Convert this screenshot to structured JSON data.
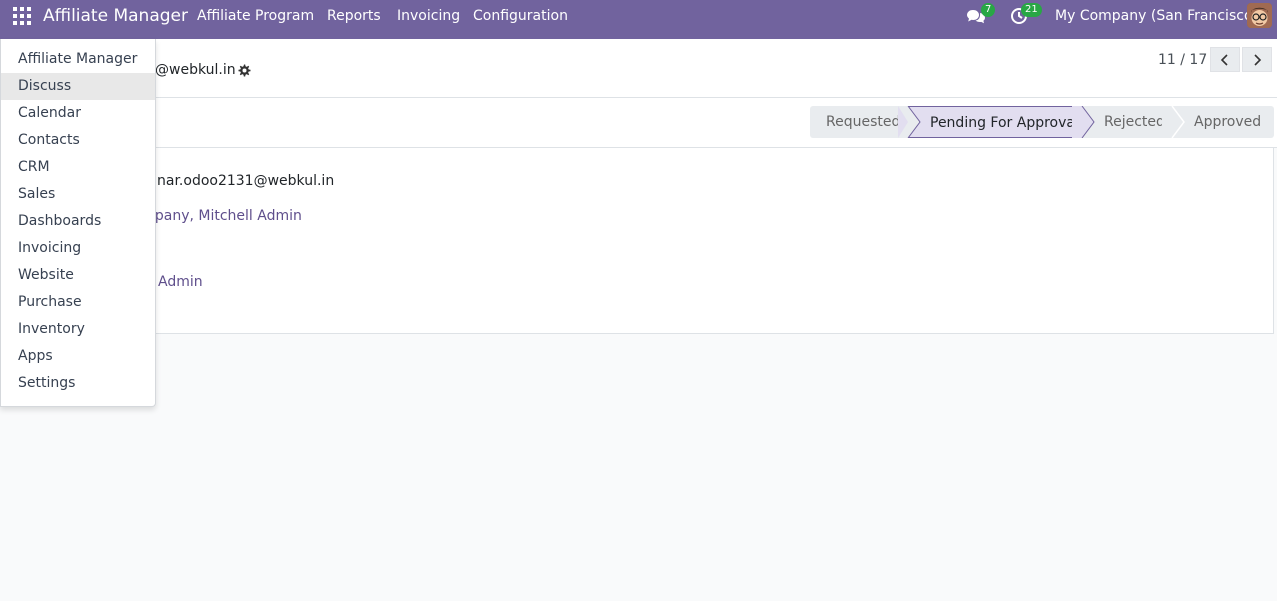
{
  "navbar": {
    "brand": "Affiliate Manager",
    "menus": [
      "Affiliate Program",
      "Reports",
      "Invoicing",
      "Configuration"
    ],
    "messages_count": "7",
    "activities_count": "21",
    "company": "My Company (San Francisco)",
    "accent_color": "#71639e"
  },
  "record": {
    "title_visible": "@webkul.in",
    "pager": "11 / 17"
  },
  "statusbar": {
    "stages": [
      "Requested",
      "Pending For Approval",
      "Rejected",
      "Approved"
    ],
    "active_stage": "Pending For Approval"
  },
  "form": {
    "email_visible": "nar.odoo2131@webkul.in",
    "related_visible": "npany, Mitchell Admin",
    "user_visible": "Admin"
  },
  "apps_menu": {
    "items": [
      "Affiliate Manager",
      "Discuss",
      "Calendar",
      "Contacts",
      "CRM",
      "Sales",
      "Dashboards",
      "Invoicing",
      "Website",
      "Purchase",
      "Inventory",
      "Apps",
      "Settings"
    ],
    "hovered": "Discuss"
  }
}
